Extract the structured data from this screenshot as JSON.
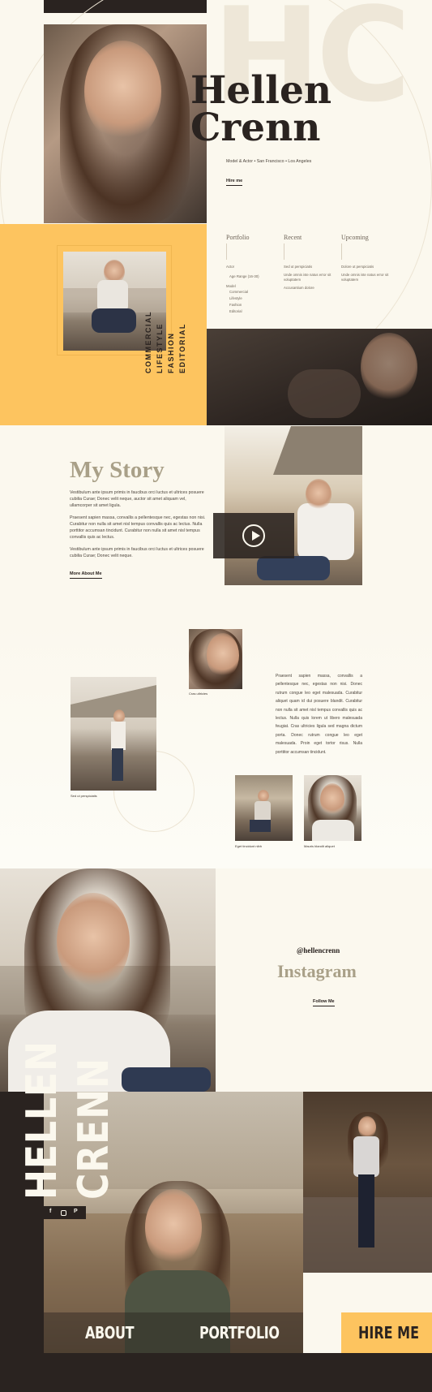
{
  "hero": {
    "watermark": "HC",
    "first_name": "Hellen",
    "last_name": "Crenn",
    "tagline": "Model & Actor • San Francisco • Los Angeles",
    "cta": "Hire me"
  },
  "nav": {
    "columns": [
      {
        "title": "Portfolio",
        "items": [
          "Actor",
          "Age Range (16-30)",
          "Model",
          "Commercial",
          "Lifestyle",
          "Fashion",
          "Editorial"
        ]
      },
      {
        "title": "Recent",
        "items": [
          "Sed ut perspiciatis",
          "Unde omnis iste natus error sit voluptatem",
          "Accusantium dolore"
        ]
      },
      {
        "title": "Upcoming",
        "items": [
          "Dolore ut perspiciatis",
          "Unde omnis iste natus error sit voluptatem"
        ]
      }
    ]
  },
  "categories": [
    "COMMERCIAL",
    "LIFESTYLE",
    "FASHION",
    "EDITORIAL"
  ],
  "story": {
    "title": "My Story",
    "paragraphs": [
      "Vestibulum ante ipsum primis in faucibus orci luctus et ultrices posuere cubilia Curae; Donec velit neque, auctor sit amet aliquam vel, ullamcorper sit amet ligula.",
      "Praesent sapien massa, convallis a pellentesque nec, egestas non nisi. Curabitur non nulla sit amet nisl tempus convallis quis ac lectus. Nulla porttitor accumsan tincidunt. Curabitur non nulla sit amet nisl tempus convallis quis ac lectus.",
      "Vestibulum ante ipsum primis in faucibus orci luctus et ultrices posuere cubilia Curae; Donec velit neque."
    ],
    "link": "More About Me"
  },
  "gallery": {
    "captions": [
      "Cras ultricies",
      "Sed ut perspiciatis",
      "Eget tincidunt nibh",
      "Mauris blandit aliquet"
    ],
    "text": "Praesent sapien massa, convallis a pellentesque nec, egestas non nisi. Donec rutrum congue leo eget malesuada. Curabitur aliquet quam id dui posuere blandit. Curabitur non nulla sit amet nisl tempus convallis quis ac lectus. Nulla quis lorem ut libero malesuada feugiat. Cras ultricies ligula sed magna dictum porta. Donec rutrum congue leo eget malesuada. Proin eget tortor risus. Nulla porttitor accumsan tincidunt."
  },
  "instagram": {
    "handle": "@hellencrenn",
    "title": "Instagram",
    "link": "Follow Me"
  },
  "footer": {
    "name_line1": "HELLEN",
    "name_line2": "CRENN",
    "social_icons": [
      "facebook-icon",
      "instagram-icon",
      "pinterest-icon"
    ],
    "about": "ABOUT",
    "portfolio": "PORTFOLIO",
    "hire": "HIRE ME"
  },
  "colors": {
    "cream": "#fbf8ee",
    "yellow": "#fdc45f",
    "dark": "#2a2320",
    "olive": "#a9a088"
  }
}
